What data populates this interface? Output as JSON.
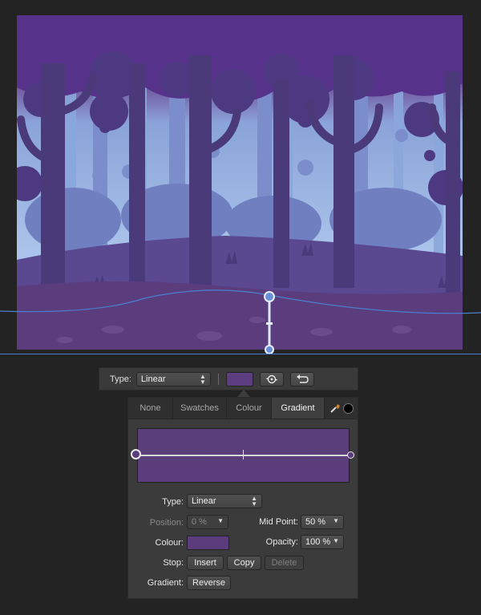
{
  "canvas": {
    "artwork": "forest-illustration",
    "colors": {
      "sky_top": "#6e337f",
      "sky_bottom": "#9eb8e2",
      "ground": "#5b3d7e",
      "trees_dark": "#4a3a7a",
      "trees_light": "#7c8fc8",
      "guide": "#4a7fd0"
    }
  },
  "toolbar": {
    "type_label": "Type:",
    "type_value": "Linear",
    "swatch_color": "#5b3d7e",
    "swap_icon": "swap-icon",
    "undo_icon": "rotate-back-icon"
  },
  "panel": {
    "tabs": [
      {
        "label": "None"
      },
      {
        "label": "Swatches"
      },
      {
        "label": "Colour"
      },
      {
        "label": "Gradient",
        "active": true
      }
    ],
    "tools": {
      "picker_icon": "color-picker-icon",
      "circle_icon": "fill-circle-icon"
    },
    "preview": {
      "start_color": "#5a3e78",
      "end_color": "#5b3d7e",
      "mid_point_pct": 50
    },
    "type_label": "Type:",
    "type_value": "Linear",
    "position_label": "Position:",
    "position_value": "0 %",
    "mid_point_label": "Mid Point:",
    "mid_point_value": "50 %",
    "colour_label": "Colour:",
    "colour_value": "#5b3d7e",
    "opacity_label": "Opacity:",
    "opacity_value": "100 %",
    "stop_label": "Stop:",
    "insert_label": "Insert",
    "copy_label": "Copy",
    "delete_label": "Delete",
    "gradient_label": "Gradient:",
    "reverse_label": "Reverse"
  }
}
